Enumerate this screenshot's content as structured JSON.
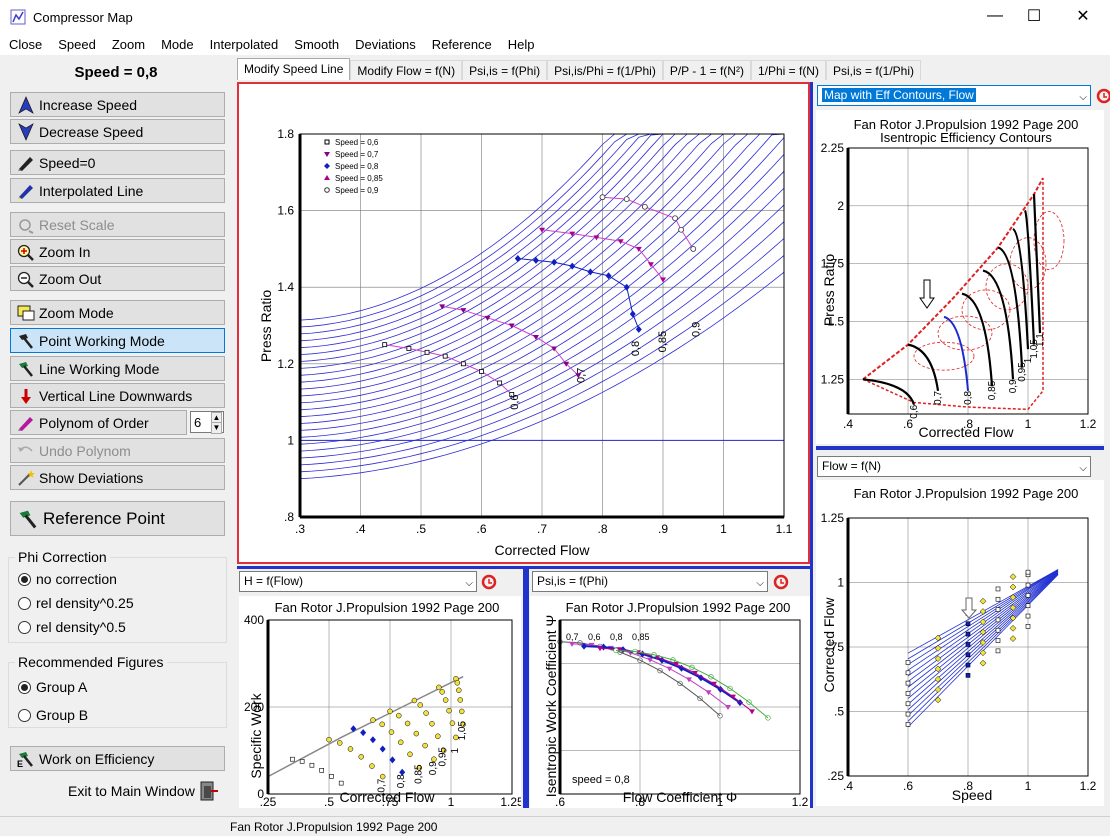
{
  "window": {
    "title": "Compressor Map",
    "minimize": "—",
    "maximize": "☐",
    "close": "✕"
  },
  "menu": [
    "Close",
    "Speed",
    "Zoom",
    "Mode",
    "Interpolated",
    "Smooth",
    "Deviations",
    "Reference",
    "Help"
  ],
  "left": {
    "speed_title": "Speed = 0,8",
    "buttons": {
      "increase": "Increase Speed",
      "decrease": "Decrease Speed",
      "speed0": "Speed=0",
      "interp": "Interpolated Line",
      "reset": "Reset Scale",
      "zoomin": "Zoom In",
      "zoomout": "Zoom Out",
      "zoommode": "Zoom Mode",
      "point": "Point Working Mode",
      "line": "Line Working Mode",
      "vertical": "Vertical Line Downwards",
      "polynom": "Polynom of Order",
      "undo": "Undo Polynom",
      "deviations": "Show Deviations",
      "reference": "Reference Point",
      "work": "Work on Efficiency"
    },
    "polynom_order": "6",
    "phi": {
      "title": "Phi Correction",
      "opts": [
        "no correction",
        "rel density^0.25",
        "rel density^0.5"
      ]
    },
    "figures": {
      "title": "Recommended Figures",
      "opts": [
        "Group A",
        "Group B"
      ]
    },
    "exit": "Exit to Main Window"
  },
  "tabs": [
    "Modify Speed Line",
    "Modify Flow = f(N)",
    "Psi,is = f(Phi)",
    "Psi,is/Phi = f(1/Phi)",
    "P/P - 1 = f(N²)",
    "1/Phi = f(N)",
    "Psi,is = f(1/Phi)"
  ],
  "main_chart": {
    "xlabel": "Corrected Flow",
    "ylabel": "Press Ratio",
    "xticks": [
      ".3",
      ".4",
      ".5",
      ".6",
      ".7",
      ".8",
      ".9",
      "1",
      "1.1"
    ],
    "yticks": [
      ".8",
      "1",
      "1.2",
      "1.4",
      "1.6",
      "1.8"
    ],
    "legend": [
      "Speed = 0,6",
      "Speed = 0,7",
      "Speed = 0,8",
      "Speed = 0,85",
      "Speed = 0,9"
    ],
    "line_labels": [
      "0,6",
      "0,7",
      "0,8",
      "0,85",
      "0,9"
    ]
  },
  "right_top": {
    "dropdown": "Map with Eff Contours, Flow",
    "title1": "Fan Rotor J.Propulsion 1992 Page 200",
    "title2": "Isentropic Efficiency Contours",
    "xlabel": "Corrected Flow",
    "ylabel": "Press Ratio",
    "xticks": [
      ".4",
      ".6",
      ".8",
      "1",
      "1.2"
    ],
    "yticks": [
      "1.25",
      "1.5",
      "1.75",
      "2",
      "2.25"
    ],
    "speed_labels": [
      "0,6",
      "0,7",
      "0,8",
      "0,85",
      "0,9",
      "0,95",
      "1",
      "1,05",
      "1,1"
    ]
  },
  "right_bottom": {
    "dropdown": "Flow = f(N)",
    "title": "Fan Rotor J.Propulsion 1992 Page 200",
    "xlabel": "Speed",
    "ylabel": "Corrected Flow",
    "xticks": [
      ".4",
      ".6",
      ".8",
      "1",
      "1.2"
    ],
    "yticks": [
      ".25",
      ".5",
      ".75",
      "1",
      "1.25"
    ]
  },
  "bottom_left": {
    "dropdown": "H = f(Flow)",
    "title": "Fan Rotor J.Propulsion 1992 Page 200",
    "xlabel": "Corrected Flow",
    "ylabel": "Specific Work",
    "xticks": [
      ".25",
      ".5",
      ".75",
      "1",
      "1.25"
    ],
    "yticks": [
      "0",
      "200",
      "400"
    ],
    "speed_labels": [
      "0,7",
      "0,8",
      "0,85",
      "0,9",
      "0,95",
      "1",
      "1,05",
      "1,1"
    ]
  },
  "bottom_mid": {
    "dropdown": "Psi,is = f(Phi)",
    "title": "Fan Rotor J.Propulsion 1992 Page 200",
    "xlabel": "Flow Coefficient Φ",
    "ylabel": "Isentropic Work Coefficient Ψ",
    "xticks": [
      ".6",
      ".8",
      "1",
      "1.2"
    ],
    "note": "speed = 0,8",
    "peak_labels": [
      "0,7",
      "0,6",
      "0,8",
      "0,85"
    ]
  },
  "status": "Fan Rotor J.Propulsion 1992 Page 200"
}
